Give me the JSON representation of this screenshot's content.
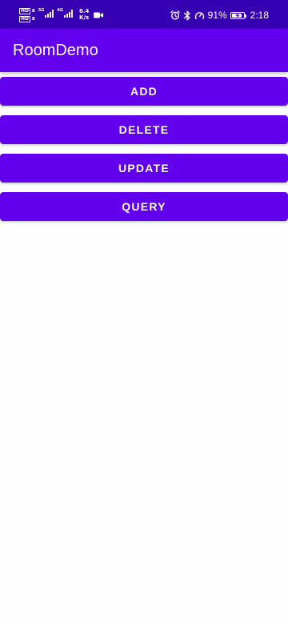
{
  "status_bar": {
    "hd1": "HD",
    "hd1_suffix": "B",
    "hd2": "HD",
    "hd2_suffix": "B",
    "net_top": "5G",
    "net_mid": "4G",
    "speed_value": "6.4",
    "speed_unit": "K/s",
    "battery_percent": "91%",
    "battery_level": 0.91,
    "time": "2:18",
    "icons": [
      "video-camera-icon",
      "alarm-icon",
      "bluetooth-icon",
      "speedometer-icon",
      "battery-charging-icon"
    ]
  },
  "app_bar": {
    "title": "RoomDemo"
  },
  "buttons": {
    "add": "ADD",
    "delete": "DELETE",
    "update": "UPDATE",
    "query": "QUERY"
  },
  "colors": {
    "status_bar": "#3700b3",
    "primary": "#6200ee",
    "background": "#fefefe",
    "on_primary": "#ffffff"
  }
}
